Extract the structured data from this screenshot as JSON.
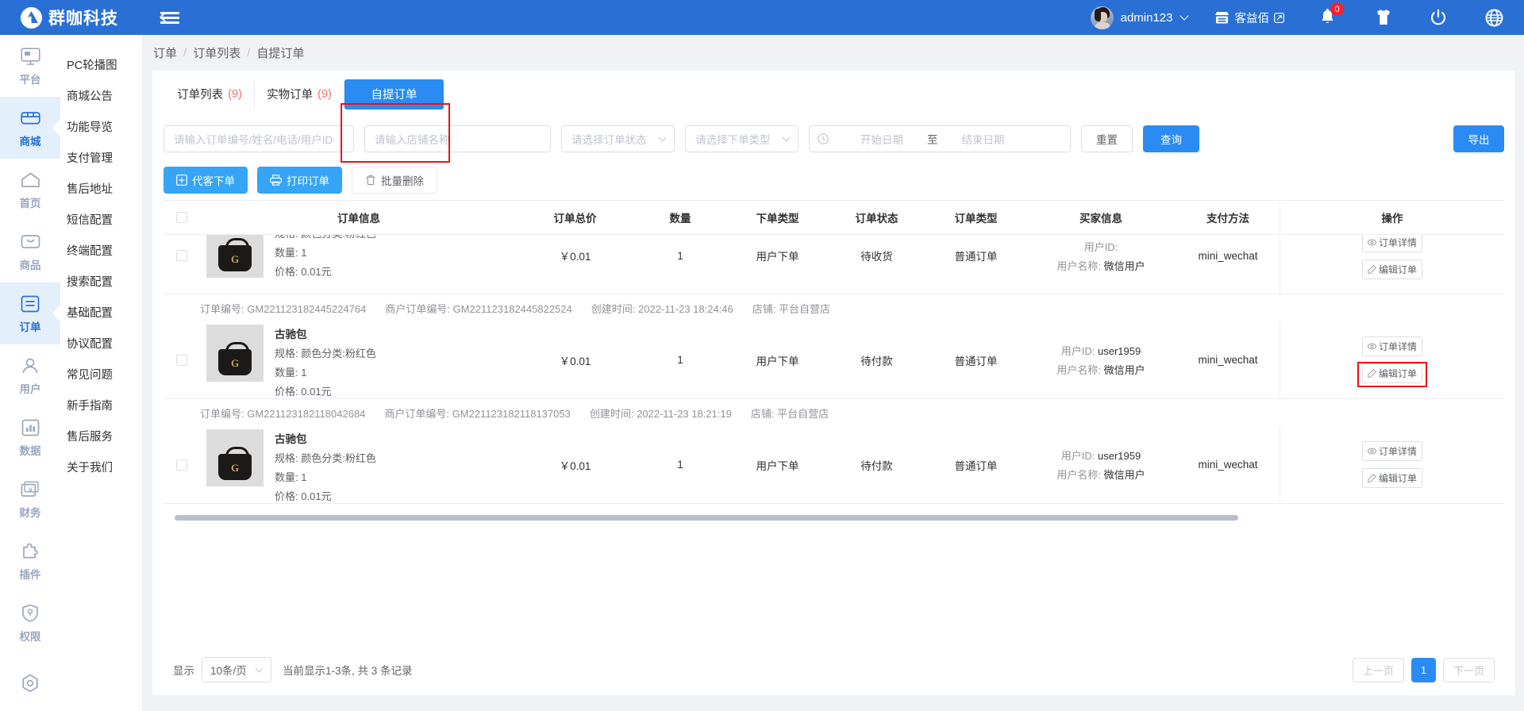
{
  "header": {
    "brand": "群咖科技",
    "user_name": "admin123",
    "shop_name": "客益佰",
    "notification_count": "0",
    "icons": [
      "menu-toggle-icon",
      "shop-icon",
      "external-link-icon",
      "bell-icon",
      "tshirt-icon",
      "power-icon",
      "globe-icon"
    ]
  },
  "sidebar": {
    "items": [
      {
        "label": "平台",
        "icon": "monitor-icon",
        "active": false
      },
      {
        "label": "商城",
        "icon": "mall-icon",
        "active": true
      },
      {
        "label": "首页",
        "icon": "home-icon",
        "active": false
      },
      {
        "label": "商品",
        "icon": "goods-icon",
        "active": false
      },
      {
        "label": "订单",
        "icon": "order-icon",
        "active": true
      },
      {
        "label": "用户",
        "icon": "user-icon",
        "active": false
      },
      {
        "label": "数据",
        "icon": "chart-icon",
        "active": false
      },
      {
        "label": "财务",
        "icon": "finance-icon",
        "active": false
      },
      {
        "label": "插件",
        "icon": "plugin-icon",
        "active": false
      },
      {
        "label": "权限",
        "icon": "shield-icon",
        "active": false
      },
      {
        "label": "",
        "icon": "settings-icon",
        "active": false
      }
    ]
  },
  "submenu": {
    "items": [
      {
        "label": "PC轮播图"
      },
      {
        "label": "商城公告"
      },
      {
        "label": "功能导览"
      },
      {
        "label": "支付管理"
      },
      {
        "label": "售后地址"
      },
      {
        "label": "短信配置"
      },
      {
        "label": "终端配置"
      },
      {
        "label": "搜索配置"
      },
      {
        "label": "基础配置"
      },
      {
        "label": "协议配置"
      },
      {
        "label": "常见问题"
      },
      {
        "label": "新手指南"
      },
      {
        "label": "售后服务"
      },
      {
        "label": "关于我们"
      }
    ]
  },
  "breadcrumb": {
    "items": [
      "订单",
      "订单列表",
      "自提订单"
    ],
    "separator": "/"
  },
  "tabs": [
    {
      "label": "订单列表",
      "count": "(9)",
      "active": false
    },
    {
      "label": "实物订单",
      "count": "(9)",
      "active": false
    },
    {
      "label": "自提订单",
      "count": "",
      "active": true
    }
  ],
  "filters": {
    "keyword_placeholder": "请输入订单编号/姓名/电话/用户ID",
    "shop_placeholder": "请输入店铺名称",
    "order_status_placeholder": "请选择订单状态",
    "order_type_placeholder": "请选择下单类型",
    "start_date_placeholder": "开始日期",
    "date_separator": "至",
    "end_date_placeholder": "结束日期",
    "reset_label": "重置",
    "search_label": "查询",
    "export_label": "导出"
  },
  "actions": {
    "proxy_order_label": "代客下单",
    "print_order_label": "打印订单",
    "batch_delete_label": "批量删除"
  },
  "table": {
    "columns": [
      "订单信息",
      "订单总价",
      "数量",
      "下单类型",
      "订单状态",
      "订单类型",
      "买家信息",
      "支付方法",
      "操作"
    ],
    "meta_labels": {
      "order_no": "订单编号:",
      "merchant_no": "商户订单编号:",
      "created": "创建时间:",
      "shop": "店铺:"
    },
    "product_labels": {
      "spec": "规格:",
      "qty": "数量:",
      "price": "价格:"
    },
    "buyer_labels": {
      "user_id": "用户ID:",
      "user_name": "用户名称:"
    },
    "op_labels": {
      "detail": "订单详情",
      "edit": "编辑订单"
    },
    "rows": [
      {
        "order_no": "",
        "merchant_no": "",
        "created": "",
        "shop": "",
        "product_name": "",
        "spec": "颜色分类:粉红色",
        "qty": "1",
        "price": "0.01元",
        "total": "￥0.01",
        "count": "1",
        "order_type": "用户下单",
        "order_status": "待收货",
        "order_cat": "普通订单",
        "user_id": "",
        "user_name": "微信用户",
        "pay_method": "mini_wechat",
        "partial": true
      },
      {
        "order_no": "GM221123182445224764",
        "merchant_no": "GM221123182445822524",
        "created": "2022-11-23 18:24:46",
        "shop": "平台自营店",
        "product_name": "古驰包",
        "spec": "颜色分类:粉红色",
        "qty": "1",
        "price": "0.01元",
        "total": "￥0.01",
        "count": "1",
        "order_type": "用户下单",
        "order_status": "待付款",
        "order_cat": "普通订单",
        "user_id": "user1959",
        "user_name": "微信用户",
        "pay_method": "mini_wechat",
        "partial": false
      },
      {
        "order_no": "GM221123182118042684",
        "merchant_no": "GM221123182118137053",
        "created": "2022-11-23 18:21:19",
        "shop": "平台自营店",
        "product_name": "古驰包",
        "spec": "颜色分类:粉红色",
        "qty": "1",
        "price": "0.01元",
        "total": "￥0.01",
        "count": "1",
        "order_type": "用户下单",
        "order_status": "待付款",
        "order_cat": "普通订单",
        "user_id": "user1959",
        "user_name": "微信用户",
        "pay_method": "mini_wechat",
        "partial": false
      }
    ]
  },
  "pagination": {
    "show_label": "显示",
    "page_size": "10条/页",
    "info": "当前显示1-3条, 共 3 条记录",
    "prev_label": "上一页",
    "current_page": "1",
    "next_label": "下一页"
  },
  "colors": {
    "header_blue": "#2a70d4",
    "accent_blue": "#2a8bf2",
    "action_blue": "#36a4f7",
    "highlight_red": "#f40f0f",
    "count_red": "#f56c6c",
    "badge_red": "#f5222d"
  }
}
